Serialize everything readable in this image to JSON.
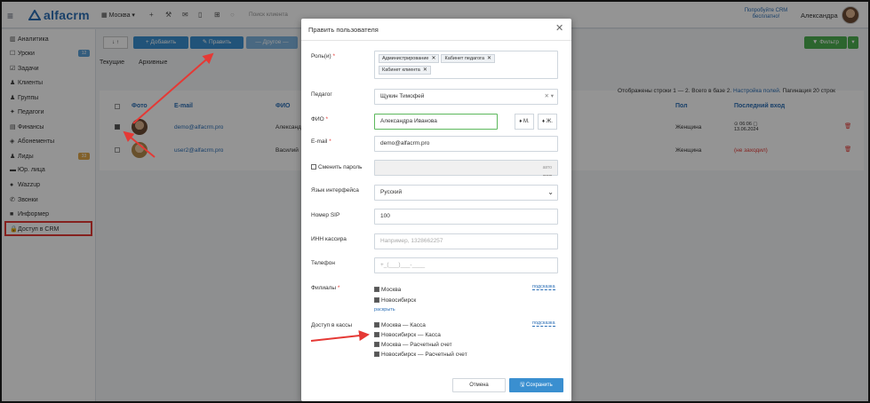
{
  "topbar": {
    "logo": "alfacrm",
    "branch": "Москва ▾",
    "search_placeholder": "Поиск клиента",
    "promo": "Попробуйте CRM бесплатно!",
    "user": "Александра"
  },
  "sidebar": {
    "items": [
      {
        "label": "Аналитика",
        "icon": "▥"
      },
      {
        "label": "Уроки",
        "icon": "☐"
      },
      {
        "label": "Задачи",
        "icon": "☑"
      },
      {
        "label": "Клиенты",
        "icon": "♟"
      },
      {
        "label": "Группы",
        "icon": "♟"
      },
      {
        "label": "Педагоги",
        "icon": "✦"
      },
      {
        "label": "Финансы",
        "icon": "▤"
      },
      {
        "label": "Абонементы",
        "icon": "◈"
      },
      {
        "label": "Лиды",
        "icon": "♟"
      },
      {
        "label": "Юр. лица",
        "icon": "▬"
      },
      {
        "label": "Wazzup",
        "icon": "●"
      },
      {
        "label": "Звонки",
        "icon": "✆"
      },
      {
        "label": "Информер",
        "icon": "■"
      },
      {
        "label": "Доступ в CRM",
        "icon": "🔒"
      }
    ],
    "badges": {
      "lessons": "12",
      "leads": "33"
    }
  },
  "main": {
    "toolbar": {
      "add": "+ Добавить",
      "edit": "✎ Править",
      "other": "— Другое —",
      "filter": "▼ Фильтр"
    },
    "tabs": [
      "Текущие",
      "Архивные"
    ],
    "pagination": "Отображены строки 1 — 2. Всего в базе 2.",
    "columns_link": "Настройка полей",
    "per_page": "Пагинация 20 строк",
    "headers": [
      "Фото",
      "E-mail",
      "ФИО",
      "Пол",
      "Последний вход"
    ],
    "rows": [
      {
        "email": "demo@alfacrm.pro",
        "name": "Александ",
        "gender": "Женщина",
        "last_login": "⊙ 06:06 ▢ 13.06.2024"
      },
      {
        "email": "user2@alfacrm.pro",
        "name": "Василий",
        "gender": "Женщина",
        "last_login": "(не заходил)"
      }
    ]
  },
  "modal": {
    "title": "Править пользователя",
    "labels": {
      "roles": "Роль(и)",
      "teacher": "Педагог",
      "fio": "ФИО",
      "email": "E-mail",
      "change_password": "Сменить пароль",
      "language": "Язык интерфейса",
      "sip": "Номер SIP",
      "inn": "ИНН кассира",
      "phone": "Телефон",
      "branches": "Филиалы",
      "cash_access": "Доступ в кассы"
    },
    "roles": [
      "Администрирование",
      "Кабинет педагога",
      "Кабинет клиента"
    ],
    "teacher": "Щукин Тимофей",
    "fio": "Александра Иванова",
    "gender_m": "♦ М.",
    "gender_f": "♦ Ж.",
    "email": "demo@alfacrm.pro",
    "password_hint": "авто",
    "language": "Русский",
    "sip": "100",
    "inn_placeholder": "Например, 1328662257",
    "phone_placeholder": "+_(___)___-____",
    "branches": [
      "Москва",
      "Новосибирск"
    ],
    "branches_expand": "раскрыть",
    "hint": "подсказка",
    "cash": [
      "Москва — Касса",
      "Новосибирск — Касса",
      "Москва — Расчетный счет",
      "Новосибирск — Расчетный счет"
    ],
    "cancel": "Отмена",
    "save": "🖫 Сохранить"
  }
}
